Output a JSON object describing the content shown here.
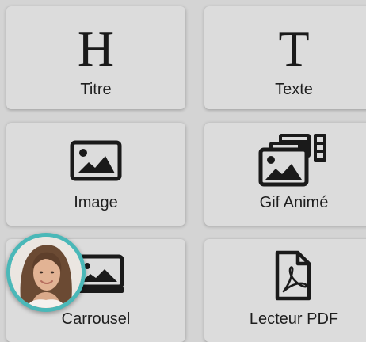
{
  "tiles": [
    {
      "label": "Titre",
      "icon": "heading-icon",
      "glyph": "H"
    },
    {
      "label": "Texte",
      "icon": "text-icon",
      "glyph": "T"
    },
    {
      "label": "Image",
      "icon": "image-icon"
    },
    {
      "label": "Gif Animé",
      "icon": "animated-gif-icon"
    },
    {
      "label": "Carrousel",
      "icon": "carousel-icon"
    },
    {
      "label": "Lecteur PDF",
      "icon": "pdf-file-icon"
    }
  ],
  "avatar": {
    "icon": "user-avatar",
    "ring_color": "#4ab8b8"
  }
}
